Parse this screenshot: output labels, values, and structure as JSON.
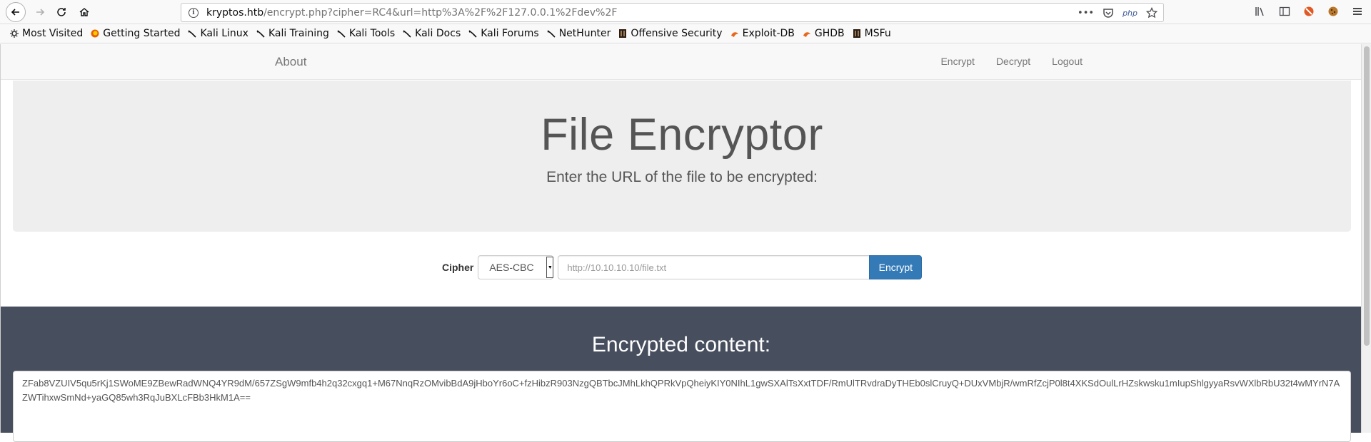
{
  "browser": {
    "url_host": "kryptos.htb",
    "url_rest": "/encrypt.php?cipher=RC4&url=http%3A%2F%2F127.0.0.1%2Fdev%2F",
    "page_actions_more": "•••",
    "php_label": "php"
  },
  "bookmarks": [
    {
      "label": "Most Visited",
      "icon": "gear-icon"
    },
    {
      "label": "Getting Started",
      "icon": "firefox-icon"
    },
    {
      "label": "Kali Linux",
      "icon": "kali-dragon-icon"
    },
    {
      "label": "Kali Training",
      "icon": "kali-dragon-icon"
    },
    {
      "label": "Kali Tools",
      "icon": "kali-dragon-icon"
    },
    {
      "label": "Kali Docs",
      "icon": "kali-dragon-icon"
    },
    {
      "label": "Kali Forums",
      "icon": "kali-dragon-icon"
    },
    {
      "label": "NetHunter",
      "icon": "kali-dragon-icon"
    },
    {
      "label": "Offensive Security",
      "icon": "offsec-icon"
    },
    {
      "label": "Exploit-DB",
      "icon": "exploitdb-icon"
    },
    {
      "label": "GHDB",
      "icon": "exploitdb-icon"
    },
    {
      "label": "MSFu",
      "icon": "offsec-icon"
    }
  ],
  "navbar": {
    "brand": "About",
    "links": [
      "Encrypt",
      "Decrypt",
      "Logout"
    ]
  },
  "jumbotron": {
    "title": "File Encryptor",
    "subtitle": "Enter the URL of the file to be encrypted:"
  },
  "form": {
    "cipher_label": "Cipher",
    "cipher_selected": "AES-CBC",
    "url_placeholder": "http://10.10.10.10/file.txt",
    "submit_label": "Encrypt"
  },
  "result": {
    "heading": "Encrypted content:",
    "content": "ZFab8VZUIV5qu5rKj1SWoME9ZBewRadWNQ4YR9dM/657ZSgW9mfb4h2q32cxgq1+M67NnqRzOMvibBdA9jHboYr6oC+fzHibzR903NzgQBTbcJMhLkhQPRkVpQheiyKIY0NIhL1gwSXAlTsXxtTDF/RmUlTRvdraDyTHEb0slCruyQ+DUxVMbjR/wmRfZcjP0l8t4XKSdOulLrHZskwsku1mIupShlgyyaRsvWXlbRbU32t4wMYrN7AZWTihxwSmNd+yaGQ85wh3RqJuBXLcFBb3HkM1A=="
  },
  "colors": {
    "jumbotron_bg": "#eeeeee",
    "dark_section_bg": "#474e5d",
    "button_primary": "#337ab7"
  }
}
